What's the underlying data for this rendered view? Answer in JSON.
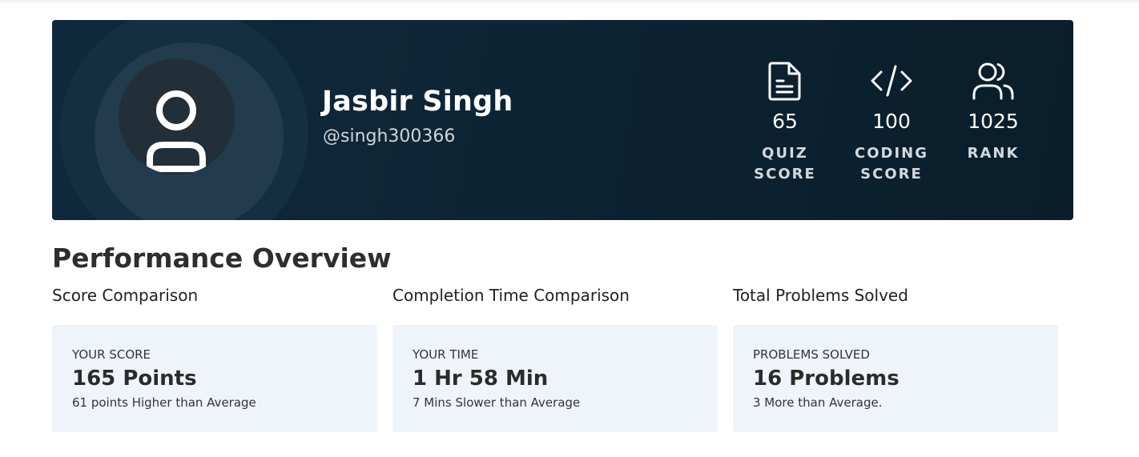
{
  "profile": {
    "name": "Jasbir Singh",
    "handle": "@singh300366",
    "avatar_icon": "user-icon"
  },
  "stats": [
    {
      "icon": "document-icon",
      "value": "65",
      "label": "QUIZ\nSCORE"
    },
    {
      "icon": "code-icon",
      "value": "100",
      "label": "CODING\nSCORE"
    },
    {
      "icon": "users-icon",
      "value": "1025",
      "label": "RANK"
    }
  ],
  "performance": {
    "title": "Performance Overview",
    "columns": [
      {
        "heading": "Score Comparison",
        "key": "YOUR SCORE",
        "value": "165 Points",
        "note": "61 points Higher than Average"
      },
      {
        "heading": "Completion Time Comparison",
        "key": "YOUR TIME",
        "value": "1 Hr 58 Min",
        "note": "7 Mins Slower than Average"
      },
      {
        "heading": "Total Problems Solved",
        "key": "PROBLEMS SOLVED",
        "value": "16 Problems",
        "note": "3 More than Average."
      }
    ]
  },
  "colors": {
    "hero_bg": "#0d2434",
    "card_bg": "#eff4fb",
    "text_dark": "#2b2b2b"
  }
}
